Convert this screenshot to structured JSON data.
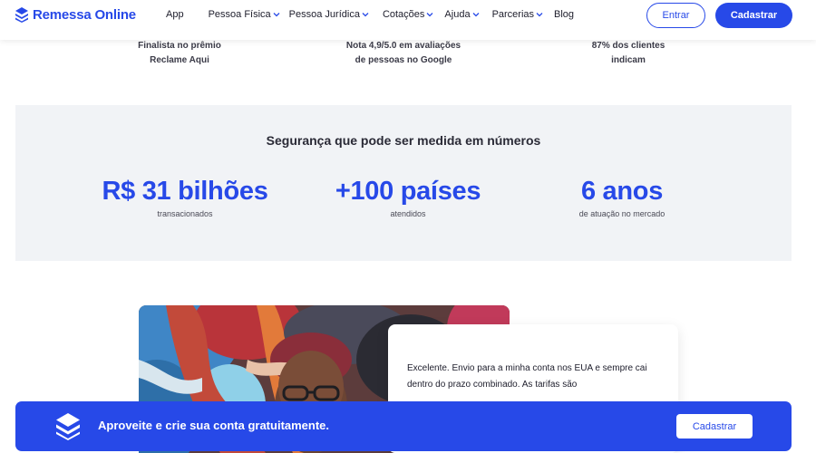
{
  "brand": {
    "name": "Remessa Online",
    "color": "#2749e8",
    "logo_icon": "layers-logo-icon"
  },
  "nav": {
    "items": [
      {
        "label": "App",
        "dropdown": false
      },
      {
        "label": "Pessoa Física",
        "dropdown": true
      },
      {
        "label": "Pessoa Jurídica",
        "dropdown": true
      },
      {
        "label": "Cotações",
        "dropdown": true
      },
      {
        "label": "Ajuda",
        "dropdown": true
      },
      {
        "label": "Parcerias",
        "dropdown": true
      },
      {
        "label": "Blog",
        "dropdown": false
      }
    ],
    "login_label": "Entrar",
    "signup_label": "Cadastrar"
  },
  "awards": [
    {
      "line1": "Finalista no prêmio",
      "line2": "Reclame Aqui"
    },
    {
      "line1": "Nota 4,9/5.0 em avaliações",
      "line2": "de pessoas no Google"
    },
    {
      "line1": "87% dos clientes",
      "line2": "indicam"
    }
  ],
  "numbers": {
    "title": "Segurança que pode ser medida em números",
    "stats": [
      {
        "value": "R$ 31 bilhões",
        "label": "transacionados"
      },
      {
        "value": "+100 países",
        "label": "atendidos"
      },
      {
        "value": "6 anos",
        "label": "de atuação no mercado"
      }
    ]
  },
  "testimonial": {
    "text": "Excelente. Envio para a minha conta nos EUA e sempre cai dentro do prazo combinado. As tarifas são"
  },
  "banner": {
    "text": "Aproveite e crie sua conta gratuitamente.",
    "button_label": "Cadastrar",
    "icon": "layers-logo-icon"
  }
}
